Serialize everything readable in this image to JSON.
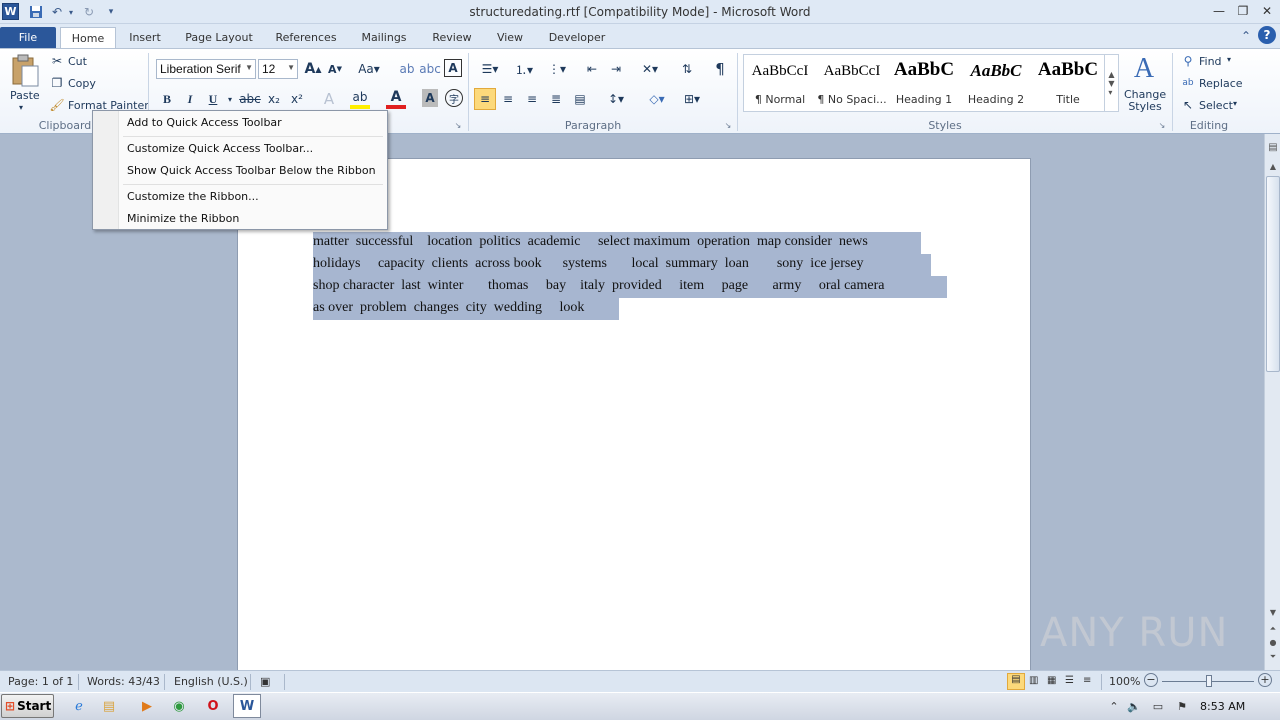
{
  "window": {
    "title": "structuredating.rtf [Compatibility Mode]  -  Microsoft Word",
    "app_icon_letter": "W"
  },
  "qat": {
    "save": "save-icon",
    "undo": "undo-icon",
    "redo": "redo-icon",
    "customize": "dropdown-icon"
  },
  "tabs": [
    "File",
    "Home",
    "Insert",
    "Page Layout",
    "References",
    "Mailings",
    "Review",
    "View",
    "Developer"
  ],
  "ribbon": {
    "clipboard": {
      "paste": "Paste",
      "cut": "Cut",
      "copy": "Copy",
      "format_painter": "Format Painter",
      "label": "Clipboard"
    },
    "font": {
      "name": "Liberation Serif",
      "size": "12",
      "bold": "B",
      "italic": "I",
      "underline": "U",
      "strike": "abc",
      "subscript": "x₂",
      "superscript": "x²"
    },
    "paragraph": {
      "label": "Paragraph",
      "pilcrow": "¶"
    },
    "styles": {
      "label": "Styles",
      "items": [
        {
          "preview": "AaBbCcI",
          "name": "¶ Normal"
        },
        {
          "preview": "AaBbCcI",
          "name": "¶ No Spaci..."
        },
        {
          "preview": "AaBbC",
          "name": "Heading 1"
        },
        {
          "preview": "AaBbC",
          "name": "Heading 2"
        },
        {
          "preview": "AaBbC",
          "name": "Title"
        }
      ],
      "change_styles": "Change Styles"
    },
    "editing": {
      "label": "Editing",
      "find": "Find",
      "replace": "Replace",
      "select": "Select"
    }
  },
  "context_menu": {
    "items": [
      "Add to Quick Access Toolbar",
      "Customize Quick Access Toolbar...",
      "Show Quick Access Toolbar Below the Ribbon",
      "Customize the Ribbon...",
      "Minimize the Ribbon"
    ]
  },
  "document": {
    "lines": [
      "matter  successful    location  politics  academic     select maximum  operation  map consider  news",
      "holidays     capacity  clients  across book      systems       local  summary  loan        sony  ice jersey",
      "shop character  last  winter       thomas     bay    italy  provided     item     page       army     oral camera",
      "as over  problem  changes  city  wedding     look"
    ]
  },
  "status": {
    "page": "Page: 1 of 1",
    "words": "Words: 43/43",
    "language": "English (U.S.)",
    "zoom": "100%"
  },
  "taskbar": {
    "start": "Start",
    "time": "8:53 AM"
  },
  "watermark": "ANY RUN"
}
